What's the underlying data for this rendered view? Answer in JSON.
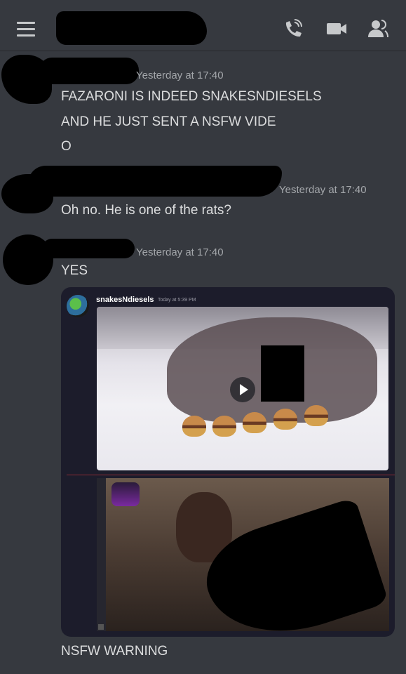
{
  "header": {
    "menu_icon": "hamburger-icon",
    "actions": [
      {
        "icon": "call-icon"
      },
      {
        "icon": "video-icon"
      },
      {
        "icon": "members-icon"
      }
    ]
  },
  "messages": [
    {
      "timestamp": "Yesterday at 17:40",
      "lines": [
        "FAZARONI IS INDEED SNAKESNDIESELS",
        "AND HE JUST SENT A NSFW VIDE",
        "O"
      ]
    },
    {
      "timestamp": "Yesterday at 17:40",
      "lines": [
        "Oh no. He is one of the rats?"
      ]
    },
    {
      "timestamp": "Yesterday at 17:40",
      "lines": [
        "YES"
      ]
    }
  ],
  "embed": {
    "author": "snakesNdiesels",
    "time": "Today at 5:39 PM"
  },
  "footer_message": "NSFW WARNING",
  "colors": {
    "background": "#36393f",
    "text": "#dcddde",
    "timestamp": "#a3a6aa",
    "embed_bg": "#1c1c2b"
  }
}
